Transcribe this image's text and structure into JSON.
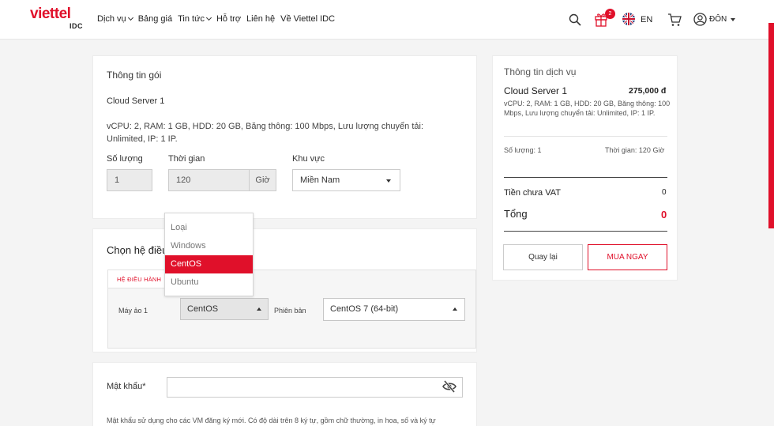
{
  "header": {
    "logo": {
      "brand": "viettel",
      "sub": "IDC"
    },
    "nav": [
      {
        "label": "Dịch vụ",
        "caret": true
      },
      {
        "label": "Bảng giá",
        "caret": false
      },
      {
        "label": "Tin tức",
        "caret": true
      },
      {
        "label": "Hỗ trợ",
        "caret": false
      },
      {
        "label": "Liên hệ",
        "caret": false
      },
      {
        "label": "Về Viettel IDC",
        "caret": false
      }
    ],
    "gift_badge": "2",
    "language": "EN",
    "user_label": "ĐÔN"
  },
  "package": {
    "title": "Thông tin gói",
    "name": "Cloud Server 1",
    "description": "vCPU: 2, RAM: 1 GB, HDD: 20 GB, Băng thông: 100 Mbps, Lưu lượng chuyển tải: Unlimited, IP: 1 IP.",
    "quantity_label": "Số lượng",
    "quantity_value": "1",
    "duration_label": "Thời gian",
    "duration_value": "120",
    "duration_unit": "Giờ",
    "region_label": "Khu vực",
    "region_value": "Miền Nam"
  },
  "os": {
    "title": "Chọn hệ điều",
    "tab_label": "HỆ ĐIỀU HÀNH",
    "vm_label": "Máy ảo 1",
    "selected": "CentOS",
    "version_label": "Phiên bản",
    "version_value": "CentOS 7 (64-bit)",
    "dropdown_options": [
      "Loại",
      "Windows",
      "CentOS",
      "Ubuntu"
    ],
    "dropdown_selected_index": 2
  },
  "password": {
    "label": "Mật khẩu*",
    "value": "",
    "note": "Mật khẩu sử dụng cho các VM đăng ký mới. Có độ dài trên 8 ký tự, gồm chữ thường, in hoa, số và ký tự"
  },
  "summary": {
    "title": "Thông tin dịch vụ",
    "product_name": "Cloud Server 1",
    "price": "275,000 đ",
    "description": "vCPU: 2, RAM: 1 GB, HDD: 20 GB, Băng thông: 100 Mbps, Lưu lượng chuyển tải: Unlimited, IP: 1 IP.",
    "quantity_text": "Số lượng: 1",
    "duration_text": "Thời gian: 120 Giờ",
    "pre_vat_label": "Tiền chưa VAT",
    "pre_vat_value": "0",
    "total_label": "Tổng",
    "total_value": "0",
    "back_button": "Quay lại",
    "buy_button": "MUA NGAY"
  },
  "colors": {
    "brand": "#e0102a",
    "background": "#f4f4f4"
  }
}
